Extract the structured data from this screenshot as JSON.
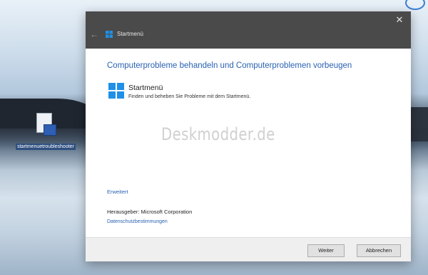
{
  "desktop": {
    "icon_label": "startmenuetroubleshooter"
  },
  "window": {
    "title": "Startmenü",
    "close_glyph": "✕",
    "back_glyph": "←"
  },
  "content": {
    "heading": "Computerprobleme behandeln und Computerproblemen vorbeugen",
    "item_title": "Startmenü",
    "item_description": "Finden und beheben Sie Probleme mit dem Startmenü.",
    "watermark": "Deskmodder.de",
    "advanced_link": "Erweitert",
    "publisher_label": "Herausgeber:",
    "publisher_value": "Microsoft Corporation",
    "privacy_link": "Datenschutzbestimmungen"
  },
  "buttons": {
    "next": "Weiter",
    "cancel": "Abbrechen"
  },
  "icons": [
    "windows-logo-icon",
    "close-icon",
    "back-arrow-icon",
    "troubleshooter-file-icon"
  ],
  "colors": {
    "accent": "#2a62b3",
    "windows_blue": "#1e90e8",
    "titlebar": "#4a4a4a"
  }
}
